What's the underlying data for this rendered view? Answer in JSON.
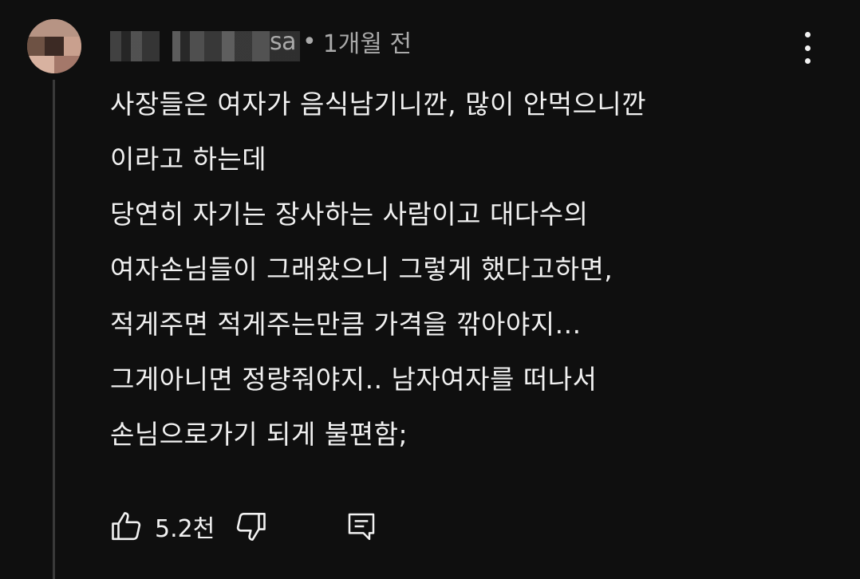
{
  "comment": {
    "author": "sa",
    "separator": "•",
    "time": "1개월 전",
    "lines": [
      "사장들은 여자가 음식남기니깐, 많이 안먹으니깐",
      "이라고 하는데",
      "당연히 자기는 장사하는 사람이고 대다수의",
      "여자손님들이 그래왔으니 그렇게 했다고하면,",
      "적게주면 적게주는만큼 가격을 깎아야지...",
      "그게아니면 정량줘야지.. 남자여자를 떠나서",
      "손님으로가기 되게 불편함;"
    ],
    "like_count": "5.2천"
  },
  "icons": {
    "like": "thumbs-up-icon",
    "dislike": "thumbs-down-icon",
    "reply": "reply-comment-icon",
    "more": "more-vertical-icon"
  },
  "colors": {
    "background": "#0f0f0f",
    "text": "#f1f1f1",
    "meta": "#aaaaaa",
    "thread_line": "#3a3a3a"
  }
}
